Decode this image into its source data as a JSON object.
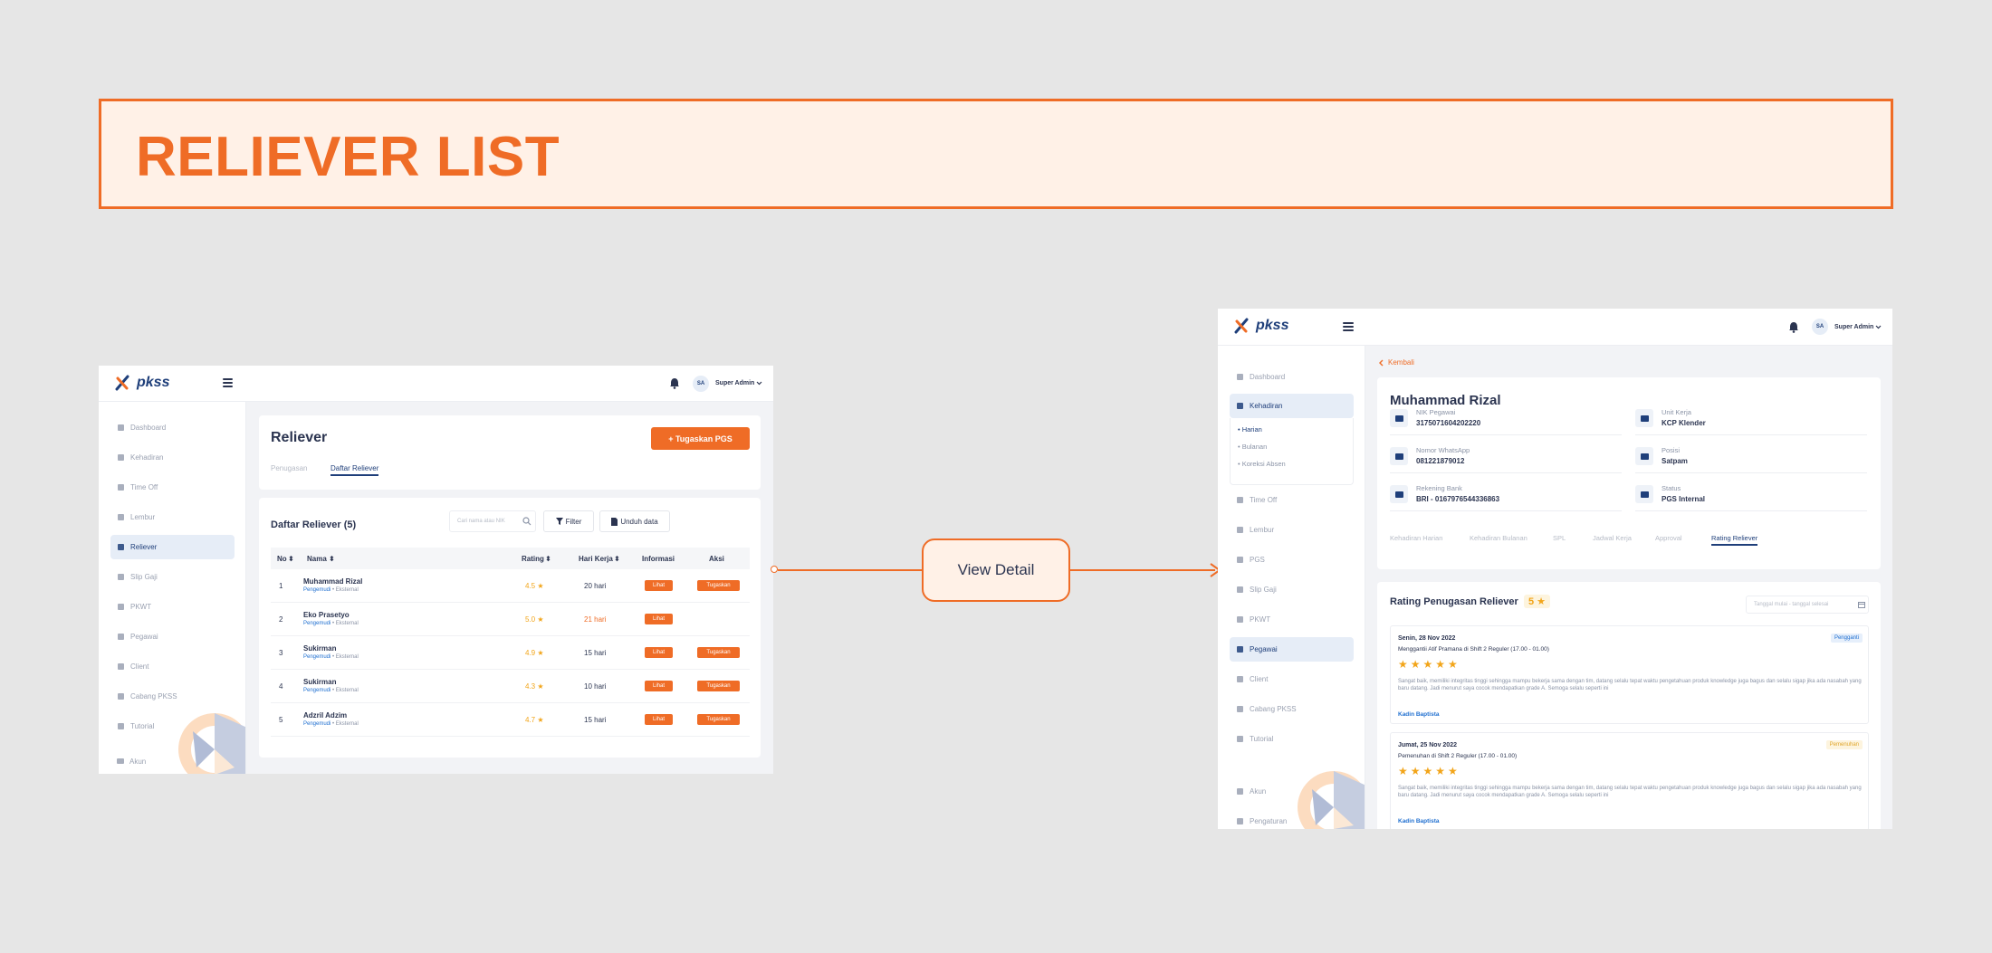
{
  "banner": {
    "title": "RELIEVER LIST"
  },
  "connector": {
    "label": "View Detail"
  },
  "colors": {
    "accent": "#ef6c26",
    "primary": "#1f3f7a",
    "star": "#f2a51a"
  },
  "app": {
    "logo": "pkss",
    "user_initials": "SA",
    "user_name": "Super Admin"
  },
  "left": {
    "sidebar": [
      {
        "label": "Dashboard",
        "icon": "home-icon",
        "active": false
      },
      {
        "label": "Kehadiran",
        "icon": "clipboard-icon",
        "active": false
      },
      {
        "label": "Time Off",
        "icon": "mail-icon",
        "active": false
      },
      {
        "label": "Lembur",
        "icon": "moon-icon",
        "active": false
      },
      {
        "label": "Reliever",
        "icon": "swap-icon",
        "active": true
      },
      {
        "label": "Slip Gaji",
        "icon": "document-icon",
        "active": false
      },
      {
        "label": "PKWT",
        "icon": "file-icon",
        "active": false
      },
      {
        "label": "Pegawai",
        "icon": "user-icon",
        "active": false
      },
      {
        "label": "Client",
        "icon": "building-icon",
        "active": false
      },
      {
        "label": "Cabang PKSS",
        "icon": "branch-icon",
        "active": false
      },
      {
        "label": "Tutorial",
        "icon": "book-icon",
        "active": false
      }
    ],
    "account": "Akun",
    "page_title": "Reliever",
    "assign_button": "+ Tugaskan PGS",
    "tabs": [
      "Penugasan",
      "Daftar Reliever"
    ],
    "list_title": "Daftar Reliever (5)",
    "search_placeholder": "Cari nama atau NIK",
    "filter_button": "Filter",
    "download_button": "Unduh data",
    "columns": [
      "No",
      "Nama",
      "Rating",
      "Hari Kerja",
      "Informasi",
      "Aksi"
    ],
    "rows": [
      {
        "no": "1",
        "name": "Muhammad Rizal",
        "dept": "Pengemudi",
        "type": "Eksternal",
        "rating": "4.5 ★",
        "days": "20 hari",
        "late": false,
        "info": "Lihat",
        "action": "Tugaskan"
      },
      {
        "no": "2",
        "name": "Eko Prasetyo",
        "dept": "Pengemudi",
        "type": "Eksternal",
        "rating": "5.0 ★",
        "days": "21 hari",
        "late": true,
        "info": "Lihat",
        "action": ""
      },
      {
        "no": "3",
        "name": "Sukirman",
        "dept": "Pengemudi",
        "type": "Eksternal",
        "rating": "4.9 ★",
        "days": "15 hari",
        "late": false,
        "info": "Lihat",
        "action": "Tugaskan"
      },
      {
        "no": "4",
        "name": "Sukirman",
        "dept": "Pengemudi",
        "type": "Eksternal",
        "rating": "4.3 ★",
        "days": "10 hari",
        "late": false,
        "info": "Lihat",
        "action": "Tugaskan"
      },
      {
        "no": "5",
        "name": "Adzril Adzim",
        "dept": "Pengemudi",
        "type": "Eksternal",
        "rating": "4.7 ★",
        "days": "15 hari",
        "late": false,
        "info": "Lihat",
        "action": "Tugaskan"
      }
    ]
  },
  "right": {
    "sidebar_top": [
      {
        "label": "Dashboard",
        "icon": "home-icon",
        "active": false
      },
      {
        "label": "Kehadiran",
        "icon": "clipboard-icon",
        "active": true
      }
    ],
    "submenu": [
      "Harian",
      "Bulanan",
      "Koreksi Absen"
    ],
    "sidebar_bottom": [
      {
        "label": "Time Off",
        "icon": "mail-icon",
        "active": false
      },
      {
        "label": "Lembur",
        "icon": "moon-icon",
        "active": false
      },
      {
        "label": "PGS",
        "icon": "swap-icon",
        "active": false
      },
      {
        "label": "Slip Gaji",
        "icon": "document-icon",
        "active": false
      },
      {
        "label": "PKWT",
        "icon": "file-icon",
        "active": false
      },
      {
        "label": "Pegawai",
        "icon": "user-icon",
        "active": true
      },
      {
        "label": "Client",
        "icon": "building-icon",
        "active": false
      },
      {
        "label": "Cabang PKSS",
        "icon": "branch-icon",
        "active": false
      },
      {
        "label": "Tutorial",
        "icon": "book-icon",
        "active": false
      }
    ],
    "account": "Akun",
    "settings": "Pengaturan",
    "back": "Kembali",
    "name": "Muhammad Rizal",
    "info": [
      {
        "label": "NIK Pegawai",
        "value": "3175071604202220"
      },
      {
        "label": "Unit Kerja",
        "value": "KCP Klender"
      },
      {
        "label": "Nomor WhatsApp",
        "value": "081221879012"
      },
      {
        "label": "Posisi",
        "value": "Satpam"
      },
      {
        "label": "Rekening Bank",
        "value": "BRI - 0167976544336863"
      },
      {
        "label": "Status",
        "value": "PGS Internal"
      }
    ],
    "tabs": [
      "Kehadiran Harian",
      "Kehadiran Bulanan",
      "SPL",
      "Jadwal Kerja",
      "Approval",
      "Rating Reliever"
    ],
    "rating_title": "Rating Penugasan Reliever",
    "rating_score": "5 ★",
    "date_placeholder": "Tanggal mulai - tanggal selesai",
    "reviews": [
      {
        "date": "Senin, 28 Nov 2022",
        "subtitle": "Menggantii Atif Pramana di Shift 2 Reguler (17.00 - 01.00)",
        "badge": "Pengganti",
        "badge_color": "#1f6fd0",
        "badge_bg": "#e6effb",
        "stars": "★★★★★",
        "text": "Sangat baik, memiliki integritas tinggi sehingga mampu bekerja sama dengan tim, datang selalu tepat waktu pengetahuan produk knowledge juga bagus dan selalu sigap jika ada nasabah yang baru datang. Jadi menurut saya cocok mendapatkan grade A. Semoga selalu seperti ini",
        "author": "Kadin Baptista"
      },
      {
        "date": "Jumat, 25 Nov 2022",
        "subtitle": "Pemenuhan di Shift 2 Reguler (17.00 - 01.00)",
        "badge": "Pemenuhan",
        "badge_color": "#e0a52a",
        "badge_bg": "#fdf4de",
        "stars": "★★★★★",
        "text": "Sangat baik, memiliki integritas tinggi sehingga mampu bekerja sama dengan tim, datang selalu tepat waktu pengetahuan produk knowledge juga bagus dan selalu sigap jika ada nasabah yang baru datang. Jadi menurut saya cocok mendapatkan grade A. Semoga selalu seperti ini",
        "author": "Kadin Baptista"
      }
    ]
  }
}
